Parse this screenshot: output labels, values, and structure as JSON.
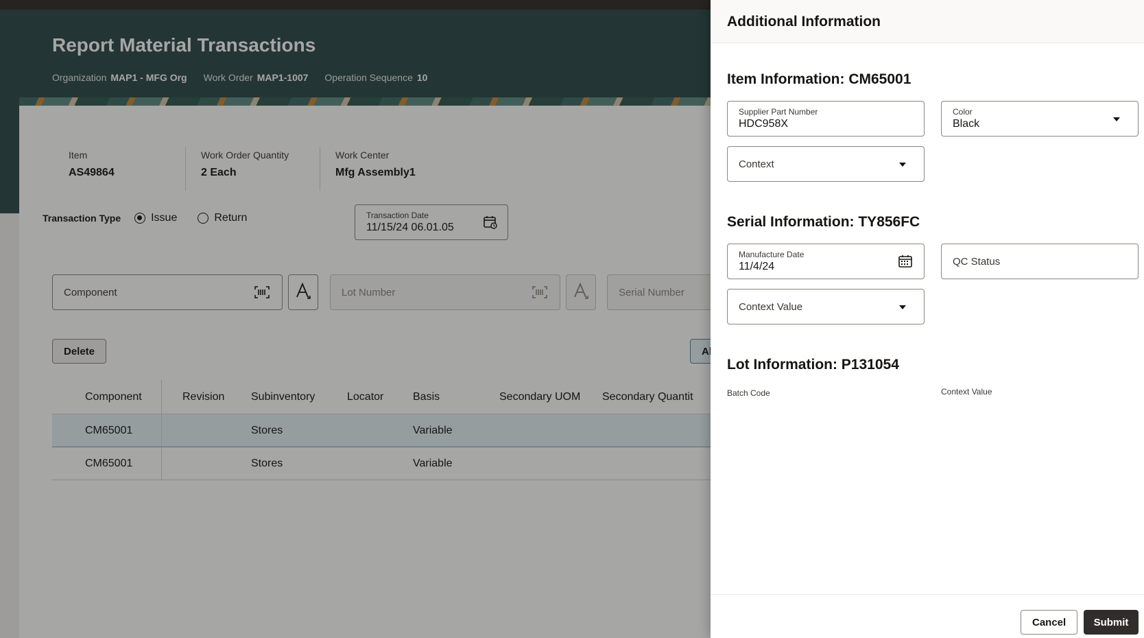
{
  "page": {
    "title": "Report Material Transactions",
    "context": [
      {
        "label": "Organization",
        "value": "MAP1 - MFG Org"
      },
      {
        "label": "Work Order",
        "value": "MAP1-1007"
      },
      {
        "label": "Operation Sequence",
        "value": "10"
      }
    ]
  },
  "summary": {
    "item_label": "Item",
    "item_value": "AS49864",
    "qty_label": "Work Order Quantity",
    "qty_value": "2 Each",
    "wc_label": "Work Center",
    "wc_value": "Mfg Assembly1"
  },
  "transaction": {
    "type_label": "Transaction Type",
    "options": [
      {
        "label": "Issue",
        "selected": true
      },
      {
        "label": "Return",
        "selected": false
      }
    ],
    "date_label": "Transaction Date",
    "date_value": "11/15/24 06.01.05"
  },
  "entry": {
    "component_placeholder": "Component",
    "lot_placeholder": "Lot Number",
    "serial_placeholder": "Serial Number"
  },
  "actions": {
    "delete_label": "Delete",
    "add_label_partial": "Al"
  },
  "table": {
    "columns": [
      "Component",
      "Revision",
      "Subinventory",
      "Locator",
      "Basis",
      "Secondary UOM",
      "Secondary Quantit"
    ],
    "rows": [
      [
        "CM65001",
        "",
        "Stores",
        "",
        "Variable",
        "",
        ""
      ],
      [
        "CM65001",
        "",
        "Stores",
        "",
        "Variable",
        "",
        ""
      ]
    ]
  },
  "drawer": {
    "title": "Additional Information",
    "item_section": "Item Information: CM65001",
    "supplier_label": "Supplier Part Number",
    "supplier_value": "HDC958X",
    "color_label": "Color",
    "color_value": "Black",
    "context_placeholder": "Context",
    "serial_section": "Serial Information: TY856FC",
    "mfg_date_label": "Manufacture Date",
    "mfg_date_value": "11/4/24",
    "qc_placeholder": "QC Status",
    "context_value_placeholder": "Context Value",
    "lot_section": "Lot Information: P131054",
    "batch_label": "Batch Code",
    "lot_context_label": "Context Value",
    "cancel_label": "Cancel",
    "submit_label": "Submit"
  },
  "colors": {
    "header_bg": "#2d4a4a",
    "primary_button": "#312d2a",
    "selected_row": "#e4f0f5"
  }
}
